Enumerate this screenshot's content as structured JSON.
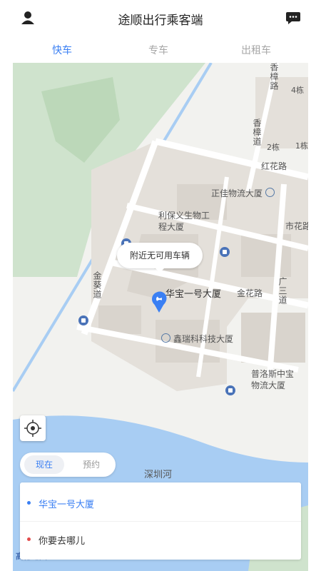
{
  "header": {
    "title": "途顺出行乘客端",
    "user_icon": "user-icon",
    "message_icon": "message-icon"
  },
  "tabs": [
    {
      "label": "快车",
      "active": true
    },
    {
      "label": "专车",
      "active": false
    },
    {
      "label": "出租车",
      "active": false
    }
  ],
  "map": {
    "bubble_text": "附近无可用车辆",
    "pin_label": "华宝一号大厦",
    "labels": {
      "xiangzhang_road_1": "香樟路",
      "xiangzhang_road_2": "香樟道",
      "building_4": "4栋",
      "building_2": "2栋",
      "building_1": "1栋",
      "honghua_road": "红花路",
      "zhengjia": "正佳物流大厦",
      "libaoyi": "利保义生物工程大厦",
      "shihua_road": "市花路",
      "jintang_road": "金葵道",
      "jinhua_road": "金花路",
      "guangsan_road": "广三道",
      "xinruike": "鑫瑞科科技大厦",
      "puluosi": "普洛斯中宝物流大厦",
      "shenzhen_river": "深圳河",
      "logo": "高德地图"
    },
    "colors": {
      "water": "#a8cdf3",
      "park": "#cfe3cd",
      "block": "#e4e0da",
      "road": "#ffffff",
      "accent": "#3a7ff3"
    }
  },
  "time_segment": [
    {
      "label": "现在",
      "active": true
    },
    {
      "label": "预约",
      "active": false
    }
  ],
  "trip": {
    "origin": "华宝一号大厦",
    "origin_color": "#3a7ff3",
    "destination_placeholder": "你要去哪儿",
    "destination_color": "#e34b4b"
  }
}
